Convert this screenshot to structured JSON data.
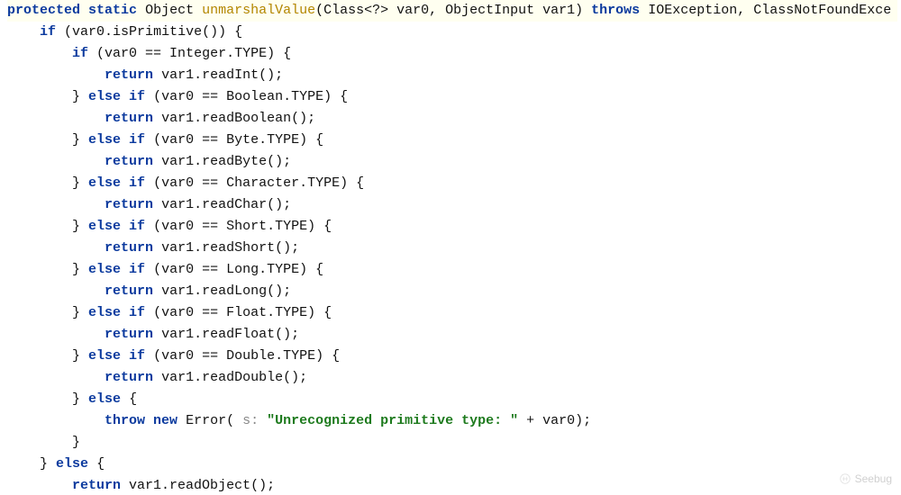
{
  "code": {
    "lines": [
      {
        "indent": 0,
        "hl": true,
        "tokens": [
          {
            "t": "kw",
            "v": "protected"
          },
          {
            "t": "sp"
          },
          {
            "t": "kw",
            "v": "static"
          },
          {
            "t": "sp"
          },
          {
            "t": "norm",
            "v": "Object "
          },
          {
            "t": "mname",
            "v": "unmarshalValue"
          },
          {
            "t": "norm",
            "v": "(Class<?> var0, ObjectInput var1) "
          },
          {
            "t": "kw",
            "v": "throws"
          },
          {
            "t": "sp"
          },
          {
            "t": "norm",
            "v": "IOException, ClassNotFoundExce"
          }
        ]
      },
      {
        "indent": 1,
        "tokens": [
          {
            "t": "kw",
            "v": "if"
          },
          {
            "t": "sp"
          },
          {
            "t": "norm",
            "v": "(var0.isPrimitive()) {"
          }
        ]
      },
      {
        "indent": 2,
        "tokens": [
          {
            "t": "kw",
            "v": "if"
          },
          {
            "t": "sp"
          },
          {
            "t": "norm",
            "v": "(var0 == Integer.TYPE) {"
          }
        ]
      },
      {
        "indent": 3,
        "tokens": [
          {
            "t": "kw",
            "v": "return"
          },
          {
            "t": "sp"
          },
          {
            "t": "norm",
            "v": "var1.readInt();"
          }
        ]
      },
      {
        "indent": 2,
        "tokens": [
          {
            "t": "norm",
            "v": "} "
          },
          {
            "t": "kw",
            "v": "else if"
          },
          {
            "t": "sp"
          },
          {
            "t": "norm",
            "v": "(var0 == Boolean.TYPE) {"
          }
        ]
      },
      {
        "indent": 3,
        "tokens": [
          {
            "t": "kw",
            "v": "return"
          },
          {
            "t": "sp"
          },
          {
            "t": "norm",
            "v": "var1.readBoolean();"
          }
        ]
      },
      {
        "indent": 2,
        "tokens": [
          {
            "t": "norm",
            "v": "} "
          },
          {
            "t": "kw",
            "v": "else if"
          },
          {
            "t": "sp"
          },
          {
            "t": "norm",
            "v": "(var0 == Byte.TYPE) {"
          }
        ]
      },
      {
        "indent": 3,
        "tokens": [
          {
            "t": "kw",
            "v": "return"
          },
          {
            "t": "sp"
          },
          {
            "t": "norm",
            "v": "var1.readByte();"
          }
        ]
      },
      {
        "indent": 2,
        "tokens": [
          {
            "t": "norm",
            "v": "} "
          },
          {
            "t": "kw",
            "v": "else if"
          },
          {
            "t": "sp"
          },
          {
            "t": "norm",
            "v": "(var0 == Character.TYPE) {"
          }
        ]
      },
      {
        "indent": 3,
        "tokens": [
          {
            "t": "kw",
            "v": "return"
          },
          {
            "t": "sp"
          },
          {
            "t": "norm",
            "v": "var1.readChar();"
          }
        ]
      },
      {
        "indent": 2,
        "tokens": [
          {
            "t": "norm",
            "v": "} "
          },
          {
            "t": "kw",
            "v": "else if"
          },
          {
            "t": "sp"
          },
          {
            "t": "norm",
            "v": "(var0 == Short.TYPE) {"
          }
        ]
      },
      {
        "indent": 3,
        "tokens": [
          {
            "t": "kw",
            "v": "return"
          },
          {
            "t": "sp"
          },
          {
            "t": "norm",
            "v": "var1.readShort();"
          }
        ]
      },
      {
        "indent": 2,
        "tokens": [
          {
            "t": "norm",
            "v": "} "
          },
          {
            "t": "kw",
            "v": "else if"
          },
          {
            "t": "sp"
          },
          {
            "t": "norm",
            "v": "(var0 == Long.TYPE) {"
          }
        ]
      },
      {
        "indent": 3,
        "tokens": [
          {
            "t": "kw",
            "v": "return"
          },
          {
            "t": "sp"
          },
          {
            "t": "norm",
            "v": "var1.readLong();"
          }
        ]
      },
      {
        "indent": 2,
        "tokens": [
          {
            "t": "norm",
            "v": "} "
          },
          {
            "t": "kw",
            "v": "else if"
          },
          {
            "t": "sp"
          },
          {
            "t": "norm",
            "v": "(var0 == Float.TYPE) {"
          }
        ]
      },
      {
        "indent": 3,
        "tokens": [
          {
            "t": "kw",
            "v": "return"
          },
          {
            "t": "sp"
          },
          {
            "t": "norm",
            "v": "var1.readFloat();"
          }
        ]
      },
      {
        "indent": 2,
        "tokens": [
          {
            "t": "norm",
            "v": "} "
          },
          {
            "t": "kw",
            "v": "else if"
          },
          {
            "t": "sp"
          },
          {
            "t": "norm",
            "v": "(var0 == Double.TYPE) {"
          }
        ]
      },
      {
        "indent": 3,
        "tokens": [
          {
            "t": "kw",
            "v": "return"
          },
          {
            "t": "sp"
          },
          {
            "t": "norm",
            "v": "var1.readDouble();"
          }
        ]
      },
      {
        "indent": 2,
        "tokens": [
          {
            "t": "norm",
            "v": "} "
          },
          {
            "t": "kw",
            "v": "else"
          },
          {
            "t": "sp"
          },
          {
            "t": "norm",
            "v": "{"
          }
        ]
      },
      {
        "indent": 3,
        "tokens": [
          {
            "t": "kw",
            "v": "throw new"
          },
          {
            "t": "sp"
          },
          {
            "t": "norm",
            "v": "Error( "
          },
          {
            "t": "hint",
            "v": "s: "
          },
          {
            "t": "str",
            "v": "\"Unrecognized primitive type: \""
          },
          {
            "t": "norm",
            "v": " + var0);"
          }
        ]
      },
      {
        "indent": 2,
        "tokens": [
          {
            "t": "norm",
            "v": "}"
          }
        ]
      },
      {
        "indent": 1,
        "tokens": [
          {
            "t": "norm",
            "v": "} "
          },
          {
            "t": "kw",
            "v": "else"
          },
          {
            "t": "sp"
          },
          {
            "t": "norm",
            "v": "{"
          }
        ]
      },
      {
        "indent": 2,
        "tokens": [
          {
            "t": "kw",
            "v": "return"
          },
          {
            "t": "sp"
          },
          {
            "t": "norm",
            "v": "var1.readObject();"
          }
        ]
      }
    ]
  },
  "watermark": {
    "text": "Seebug"
  }
}
